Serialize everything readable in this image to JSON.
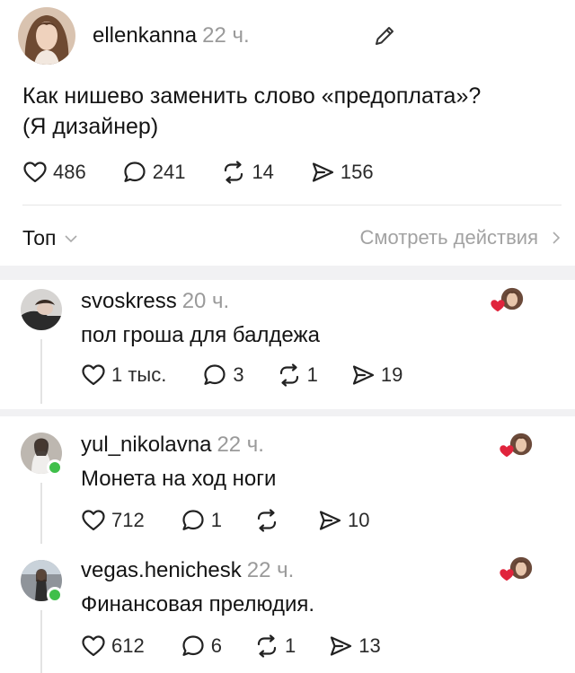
{
  "post": {
    "author": "ellenkanna",
    "time": "22 ч.",
    "text_line1": "Как нишево заменить слово «предоплата»?",
    "text_line2": "(Я дизайнер)",
    "likes": "486",
    "replies": "241",
    "reposts": "14",
    "shares": "156"
  },
  "sort": {
    "label": "Топ",
    "activity_link": "Смотреть действия"
  },
  "comments": [
    {
      "author": "svoskress",
      "time": "20 ч.",
      "text": "пол гроша для балдежа",
      "likes": "1 тыс.",
      "replies": "3",
      "reposts": "1",
      "shares": "19"
    },
    {
      "author": "yul_nikolavna",
      "time": "22 ч.",
      "text": "Монета на ход ноги",
      "likes": "712",
      "replies": "1",
      "reposts": "",
      "shares": "10"
    },
    {
      "author": "vegas.henichesk",
      "time": "22 ч.",
      "text": "Финансовая прелюдия.",
      "likes": "612",
      "replies": "6",
      "reposts": "1",
      "shares": "13"
    }
  ],
  "icons": {
    "like": "heart-icon",
    "reply": "speech-bubble-icon",
    "repost": "repost-arrows-icon",
    "share": "send-arrow-icon",
    "edit": "pencil-icon",
    "sort_dropdown": "chevron-down-icon",
    "activity": "chevron-right-icon",
    "liked_by_author": "red-heart-icon"
  },
  "colors": {
    "online": "#3fbf4a",
    "liked_heart": "#e0243c",
    "muted_text": "#9a9a9a"
  }
}
